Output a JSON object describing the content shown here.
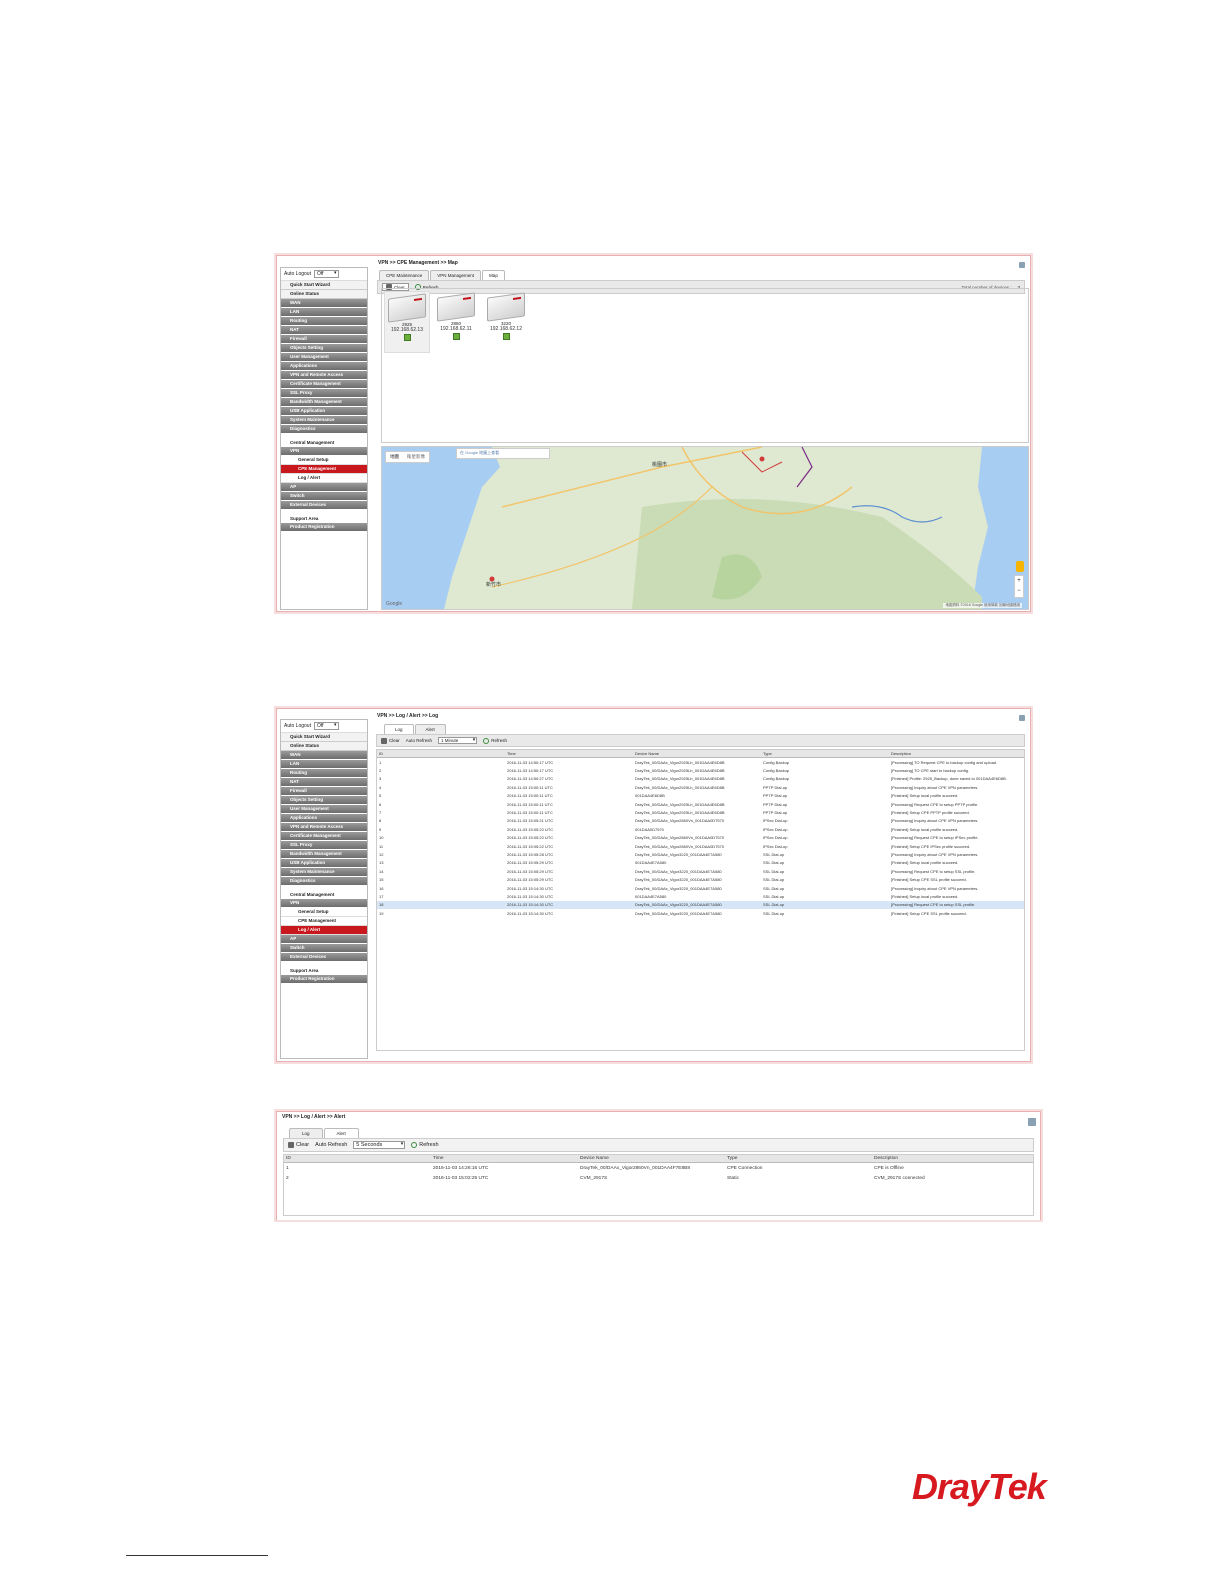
{
  "colors": {
    "brand_red": "#d71920",
    "menu_gray": "#7a7a7a",
    "active_red": "#c8181e",
    "selected_row": "#d6e6f7",
    "map_sea": "#a8cdf2",
    "map_land": "#dfe9d1"
  },
  "sidebar": {
    "auto_logout_label": "Auto Logout",
    "auto_logout_value": "Off",
    "top_items": [
      "Quick Start Wizard",
      "Online Status"
    ],
    "gray_items": [
      "WAN",
      "LAN",
      "Routing",
      "NAT",
      "Firewall",
      "Objects Setting",
      "User Management",
      "Applications",
      "VPN and Remote Access",
      "Certificate Management",
      "SSL Proxy",
      "Bandwidth Management",
      "USB Application",
      "System Maintenance",
      "Diagnostics"
    ],
    "central_head": "Central Management",
    "vpn": "VPN",
    "general_setup": "General Setup",
    "cpe_management": "CPE Management",
    "log_alert": "Log / Alert",
    "after_items": [
      "AP",
      "Switch",
      "External Devices"
    ],
    "support_head": "Support Area",
    "product_registration": "Product Registration"
  },
  "shot1": {
    "breadcrumb": "VPN >> CPE Management >> Map",
    "tabs": [
      "CPE Maintenance",
      "VPN Management",
      "Map"
    ],
    "active_tab": "Map",
    "toolbar": {
      "clear": "Clear",
      "refresh": "Refresh",
      "total_label": "Total number of devices :",
      "total": "3"
    },
    "devices": [
      {
        "model": "2925",
        "ip": "192.168.62.13"
      },
      {
        "model": "2860",
        "ip": "192.168.62.11"
      },
      {
        "model": "3220",
        "ip": "192.168.62.12"
      }
    ],
    "map": {
      "btn_map": "地圖",
      "btn_satellite": "衛星影像",
      "search_placeholder": "在 Google 地圖上查看",
      "city_label": "新竹市",
      "city2_label": "桃園市",
      "google": "Google",
      "footer": "地圖資料 ©2016 Google  使用條款  回報地圖錯誤"
    }
  },
  "shot2": {
    "breadcrumb": "VPN >> Log / Alert >> Log",
    "tabs": [
      "Log",
      "Alert"
    ],
    "active_tab": "Log",
    "toolbar": {
      "clear": "Clear",
      "auto_refresh": "Auto Refresh",
      "interval": "1 Minute",
      "refresh": "Refresh"
    },
    "columns": [
      "ID",
      "Time",
      "Device Name",
      "Type",
      "Description"
    ],
    "rows": [
      [
        "1",
        "2016-11-03 14:50:17 UTC",
        "DrayTek_00/DAAx_Vigor2925Lh_001DAA4E6D8B",
        "Config Backup",
        "[Processing] TO Request CPE to backup config and upload."
      ],
      [
        "2",
        "2016-11-03 14:50:17 UTC",
        "DrayTek_00/DAAx_Vigor2925Lh_001DAA4E6D8B",
        "Config Backup",
        "[Processing] TO CPE start to backup config."
      ],
      [
        "3",
        "2016-11-03 14:50:27 UTC",
        "DrayTek_00/DAAx_Vigor2925Lh_001DAA4E6D8B",
        "Config Backup",
        "[Finished] Profile: 2925_Backup, done saved to 001DAA4E6D8B."
      ],
      [
        "4",
        "2016-11-03 15:00:11 UTC",
        "DrayTek_00/DAAx_Vigor2925Lh_001DAA4E6D8B",
        "PPTP Dial-up",
        "[Processing] Inquiry about CPE VPN parameters."
      ],
      [
        "5",
        "2016-11-03 15:00:11 UTC",
        "001DAA4E6D8B",
        "PPTP Dial-up",
        "[Finished] Setup local profile succeed."
      ],
      [
        "6",
        "2016-11-03 15:00:11 UTC",
        "DrayTek_00/DAAx_Vigor2925Lh_001DAA4E6D8B",
        "PPTP Dial-up",
        "[Processing] Request CPE to setup PPTP profile."
      ],
      [
        "7",
        "2016-11-03 15:00:11 UTC",
        "DrayTek_00/DAAx_Vigor2925Lh_001DAA4E6D8B",
        "PPTP Dial-up",
        "[Finished] Setup CPE PPTP profile succeed."
      ],
      [
        "8",
        "2016-11-03 15:05:21 UTC",
        "DrayTek_00/DAAx_Vigor2860Vn_001DAA0D7570",
        "IPSec Dial-up",
        "[Processing] Inquiry about CPE VPN parameters."
      ],
      [
        "9",
        "2016-11-03 15:05:22 UTC",
        "001DAA0D7570",
        "IPSec Dial-up",
        "[Finished] Setup local profile succeed."
      ],
      [
        "10",
        "2016-11-03 15:05:22 UTC",
        "DrayTek_00/DAAx_Vigor2860Vn_001DAA0D7570",
        "IPSec Dial-up",
        "[Processing] Request CPE to setup IPSec profile."
      ],
      [
        "11",
        "2016-11-03 15:05:22 UTC",
        "DrayTek_00/DAAx_Vigor2860Vn_001DAA0D7570",
        "IPSec Dial-up",
        "[Finished] Setup CPE IPSec profile succeed."
      ],
      [
        "12",
        "2016-11-03 15:05:28 UTC",
        "DrayTek_00/DAAx_Vigor3220_001DAA4E7A580",
        "SSL Dial-up",
        "[Processing] Inquiry about CPE VPN parameters."
      ],
      [
        "13",
        "2016-11-03 15:05:29 UTC",
        "001DAA4E7A580",
        "SSL Dial-up",
        "[Finished] Setup local profile succeed."
      ],
      [
        "14",
        "2016-11-03 15:05:29 UTC",
        "DrayTek_00/DAAx_Vigor3220_001DAA4E7A580",
        "SSL Dial-up",
        "[Processing] Request CPE to setup SSL profile."
      ],
      [
        "15",
        "2016-11-03 15:05:29 UTC",
        "DrayTek_00/DAAx_Vigor3220_001DAA4E7A580",
        "SSL Dial-up",
        "[Finished] Setup CPE SSL profile succeed."
      ],
      [
        "16",
        "2016-11-03 15:14:30 UTC",
        "DrayTek_00/DAAx_Vigor3220_001DAA4E7A580",
        "SSL Dial-up",
        "[Processing] Inquiry about CPE VPN parameters."
      ],
      [
        "17",
        "2016-11-03 15:14:30 UTC",
        "001DAA4E7A580",
        "SSL Dial-up",
        "[Finished] Setup local profile succeed."
      ],
      [
        "18",
        "2016-11-03 15:14:30 UTC",
        "DrayTek_00/DAAx_Vigor3220_001DAA4E7A580",
        "SSL Dial-up",
        "[Processing] Request CPE to setup SSL profile."
      ],
      [
        "19",
        "2016-11-03 15:14:30 UTC",
        "DrayTek_00/DAAx_Vigor3220_001DAA4E7A580",
        "SSL Dial-up",
        "[Finished] Setup CPE SSL profile succeed."
      ]
    ],
    "selected_row": "18"
  },
  "shot3": {
    "breadcrumb": "VPN >> Log / Alert >> Alert",
    "tabs": [
      "Log",
      "Alert"
    ],
    "active_tab": "Alert",
    "toolbar": {
      "clear": "Clear",
      "auto_refresh": "Auto Refresh",
      "interval": "5 Seconds",
      "refresh": "Refresh"
    },
    "columns": [
      "ID",
      "Time",
      "Device Name",
      "Type",
      "Description"
    ],
    "rows": [
      [
        "1",
        "2016-11-03 14:26:16 UTC",
        "DrayTek_00/DAAx_Vigor2860Vn_001DAA4F7E8B8",
        "CPE Connection",
        "CPE is Offline"
      ],
      [
        "2",
        "2016-11-03 15:02:25 UTC",
        "CVM_2917S",
        "Static",
        "CVM_2917S connected"
      ]
    ]
  },
  "brand": {
    "logo": "DrayTek"
  }
}
